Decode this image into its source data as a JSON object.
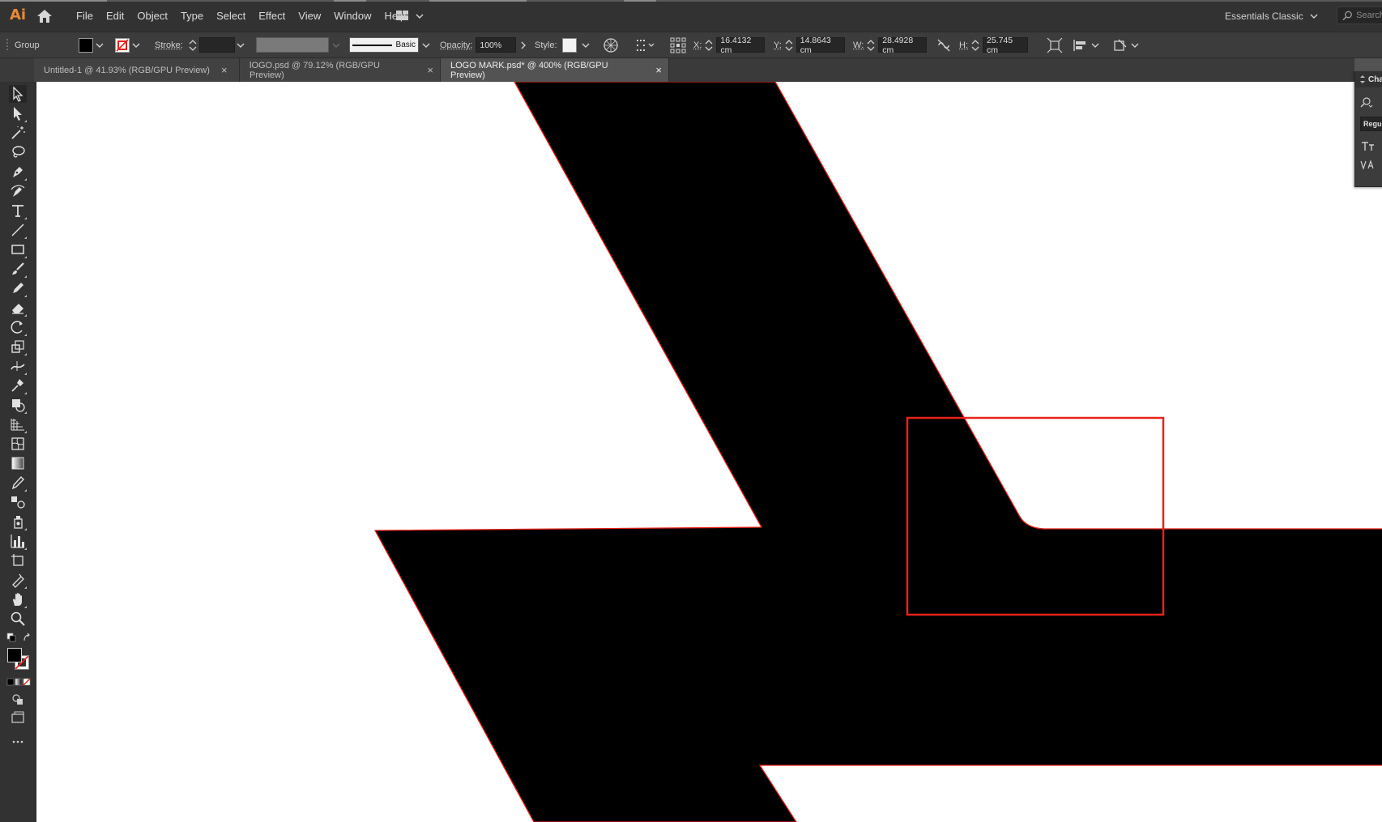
{
  "app": {
    "logo_text": "Ai"
  },
  "menu": [
    "File",
    "Edit",
    "Object",
    "Type",
    "Select",
    "Effect",
    "View",
    "Window",
    "Help"
  ],
  "workspace": {
    "label": "Essentials Classic"
  },
  "search": {
    "placeholder": "Search"
  },
  "control_bar": {
    "selection_type": "Group",
    "stroke_label": "Stroke:",
    "brush_label": "Basic",
    "opacity_label": "Opacity:",
    "opacity_value": "100%",
    "style_label": "Style:",
    "x_label": "X:",
    "x_value": "16.4132 cm",
    "y_label": "Y:",
    "y_value": "14.8643 cm",
    "w_label": "W:",
    "w_value": "28.4928 cm",
    "h_label": "H:",
    "h_value": "25.745 cm"
  },
  "tabs": [
    {
      "label": "Untitled-1 @ 41.93% (RGB/GPU Preview)",
      "close": "×",
      "active": false
    },
    {
      "label": "lOGO.psd @ 79.12% (RGB/GPU Preview)",
      "close": "×",
      "active": false
    },
    {
      "label": "LOGO MARK.psd* @ 400% (RGB/GPU Preview)",
      "close": "×",
      "active": true
    }
  ],
  "character_panel": {
    "title": "Cha",
    "font_style": "Regu"
  },
  "colors": {
    "accent_orange": "#e88a3a",
    "selection_red": "#e8231a",
    "shape_fill": "#000000",
    "artboard": "#ffffff"
  },
  "icons": {
    "home": "home-icon",
    "search": "search-icon",
    "workspace_switcher": "arrange-documents-icon"
  }
}
